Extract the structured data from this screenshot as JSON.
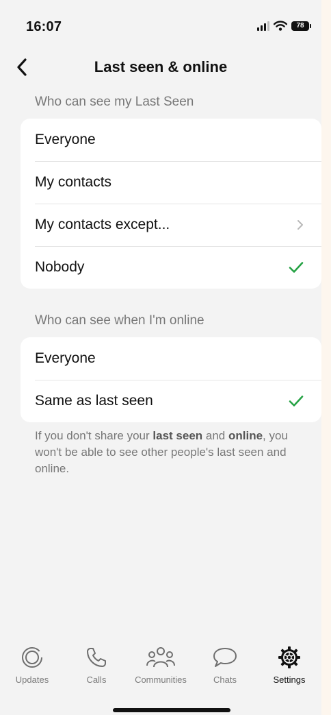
{
  "status_bar": {
    "time": "16:07",
    "battery": "78"
  },
  "nav": {
    "title": "Last seen & online"
  },
  "last_seen": {
    "header": "Who can see my Last Seen",
    "options": [
      {
        "label": "Everyone",
        "selected": false
      },
      {
        "label": "My contacts",
        "selected": false
      },
      {
        "label": "My contacts except...",
        "selected": false,
        "has_chevron": true
      },
      {
        "label": "Nobody",
        "selected": true
      }
    ]
  },
  "online": {
    "header": "Who can see when I'm online",
    "options": [
      {
        "label": "Everyone",
        "selected": false
      },
      {
        "label": "Same as last seen",
        "selected": true
      }
    ]
  },
  "footer": {
    "prefix": "If you don't share your ",
    "bold1": "last seen",
    "middle": " and ",
    "bold2": "online",
    "suffix": ", you won't be able to see other people's last seen and online."
  },
  "tabs": [
    {
      "label": "Updates",
      "icon": "updates-icon",
      "active": false
    },
    {
      "label": "Calls",
      "icon": "phone-icon",
      "active": false
    },
    {
      "label": "Communities",
      "icon": "communities-icon",
      "active": false
    },
    {
      "label": "Chats",
      "icon": "chat-bubble-icon",
      "active": false
    },
    {
      "label": "Settings",
      "icon": "gear-icon",
      "active": true
    }
  ],
  "colors": {
    "accent_check": "#25a244",
    "background": "#f3f3f3",
    "secondary_text": "#777777"
  }
}
